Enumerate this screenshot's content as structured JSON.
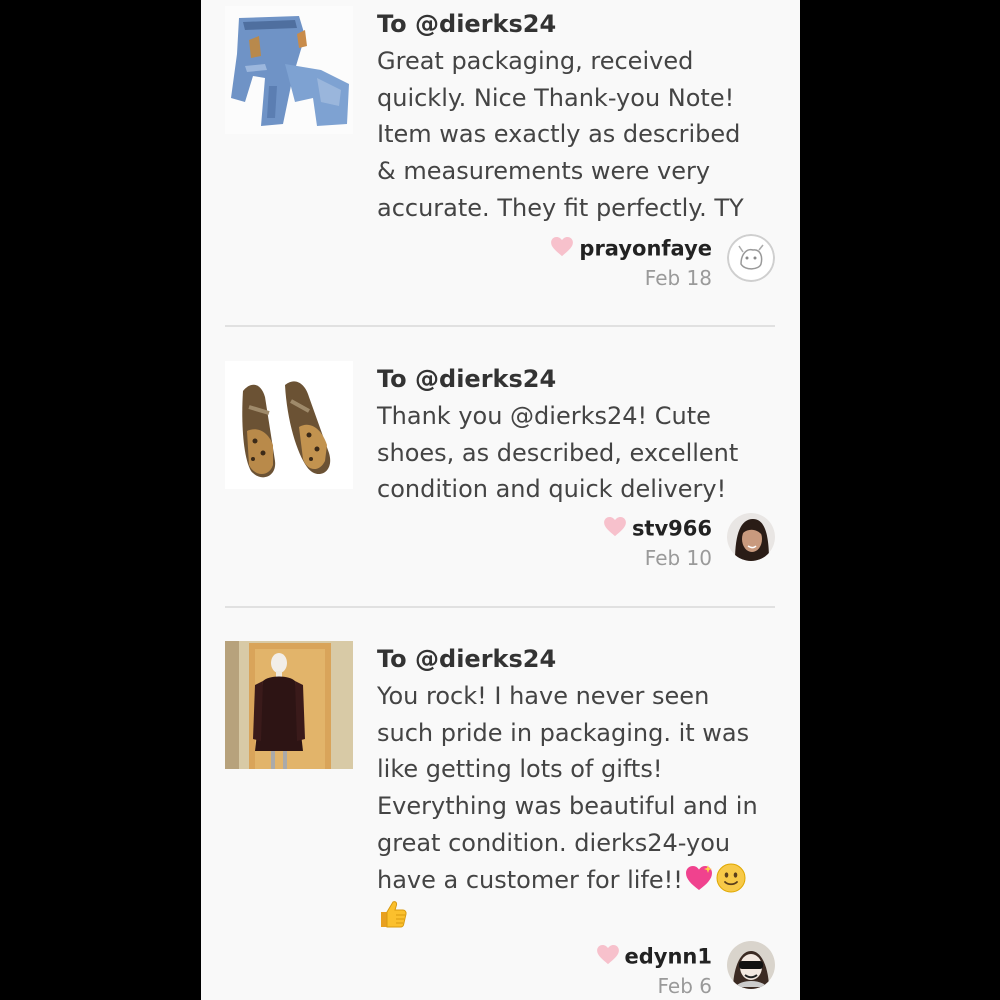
{
  "reviews": [
    {
      "to": "To @dierks24",
      "lines": [
        "Great packaging, received",
        "quickly. Nice Thank-you Note!",
        "Item was exactly as described",
        "& measurements were very",
        "accurate. They fit perfectly. TY"
      ],
      "username": "prayonfaye",
      "date": "Feb 18",
      "thumbnail": "jeans-photo",
      "avatar": "sketch-avatar"
    },
    {
      "to": "To @dierks24",
      "lines": [
        "Thank you @dierks24! Cute",
        "shoes, as described, excellent",
        "condition and quick delivery!"
      ],
      "username": "stv966",
      "date": "Feb 10",
      "thumbnail": "leopard-sandals-photo",
      "avatar": "woman-portrait-avatar"
    },
    {
      "to": "To @dierks24",
      "lines": [
        "You rock! I have never seen",
        "such pride in packaging. it was",
        "like getting lots of gifts!",
        "Everything was beautiful and in",
        "great condition. dierks24-you",
        "have a customer for life!!"
      ],
      "emojis": [
        "sparkling-heart-emoji",
        "slightly-smiling-face-emoji",
        "thumbs-up-emoji"
      ],
      "username": "edynn1",
      "date": "Feb 6",
      "thumbnail": "black-jacket-on-mannequin-photo",
      "avatar": "sunglasses-avatar"
    }
  ],
  "colors": {
    "background": "#f9f9f9",
    "heart": "#f7c1cc",
    "text": "#444444",
    "date": "#9a9a9a",
    "divider": "#e1e1e1"
  }
}
